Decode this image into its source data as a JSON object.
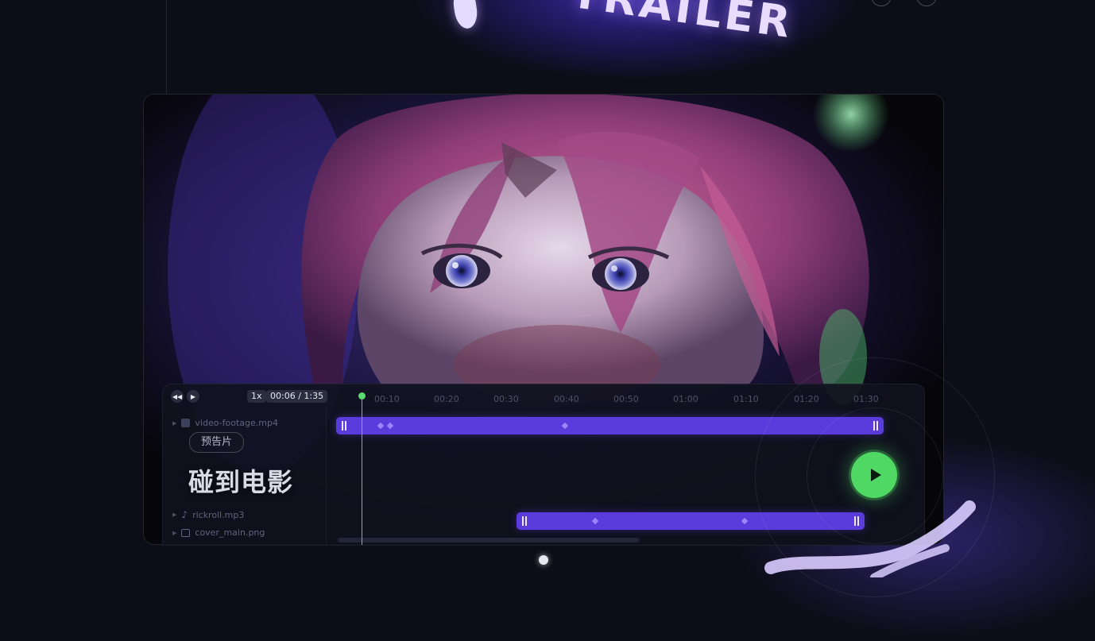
{
  "hero": {
    "word": "TRAILER"
  },
  "player": {
    "rewind_icon": "rewind-icon",
    "play_icon": "play-icon",
    "speed": "1x",
    "time": "00:06 / 1:35"
  },
  "ruler": [
    "00:10",
    "00:20",
    "00:30",
    "00:40",
    "00:50",
    "01:00",
    "01:10",
    "01:20",
    "01:30"
  ],
  "tracks": [
    {
      "label": "video-footage.mp4",
      "icon": "video-file-icon"
    },
    {
      "label": "rickroll.mp3",
      "icon": "music-note-icon"
    },
    {
      "label": "cover_main.png",
      "icon": "image-file-icon"
    }
  ],
  "chip": "预告片",
  "caption": "碰到电影",
  "colors": {
    "accent": "#5a3bdb",
    "play": "#4fd964",
    "background": "#0c0d16"
  }
}
